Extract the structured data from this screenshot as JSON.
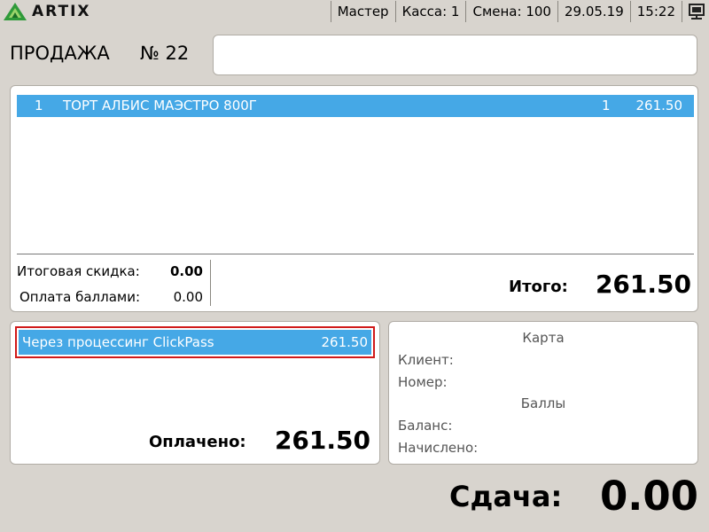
{
  "app": {
    "logo_text": "ARTIX"
  },
  "status_bar": {
    "role": "Мастер",
    "register": "Касса: 1",
    "shift": "Смена: 100",
    "date": "29.05.19",
    "time": "15:22",
    "icon": "terminal-icon"
  },
  "sale": {
    "title": "ПРОДАЖА",
    "number": "№ 22",
    "message": ""
  },
  "items": [
    {
      "index": "1",
      "name": "ТОРТ АЛБИС МАЭСТРО 800Г",
      "qty": "1",
      "sum": "261.50"
    }
  ],
  "totals": {
    "discount_label": "Итоговая скидка:",
    "discount_value": "0.00",
    "points_label": "Оплата баллами:",
    "points_value": "0.00",
    "total_label": "Итого:",
    "total_value": "261.50"
  },
  "payments": [
    {
      "name": "Через процессинг ClickPass",
      "sum": "261.50"
    }
  ],
  "paid": {
    "label": "Оплачено:",
    "value": "261.50"
  },
  "card": {
    "card_header": "Карта",
    "client_label": "Клиент:",
    "number_label": "Номер:",
    "points_header": "Баллы",
    "balance_label": "Баланс:",
    "accrued_label": "Начислено:"
  },
  "change": {
    "label": "Сдача:",
    "value": "0.00"
  },
  "colors": {
    "background": "#d8d4ce",
    "selection": "#45a8e6",
    "highlight_border": "#d01a1a",
    "logo_green": "#2f9a3a"
  }
}
